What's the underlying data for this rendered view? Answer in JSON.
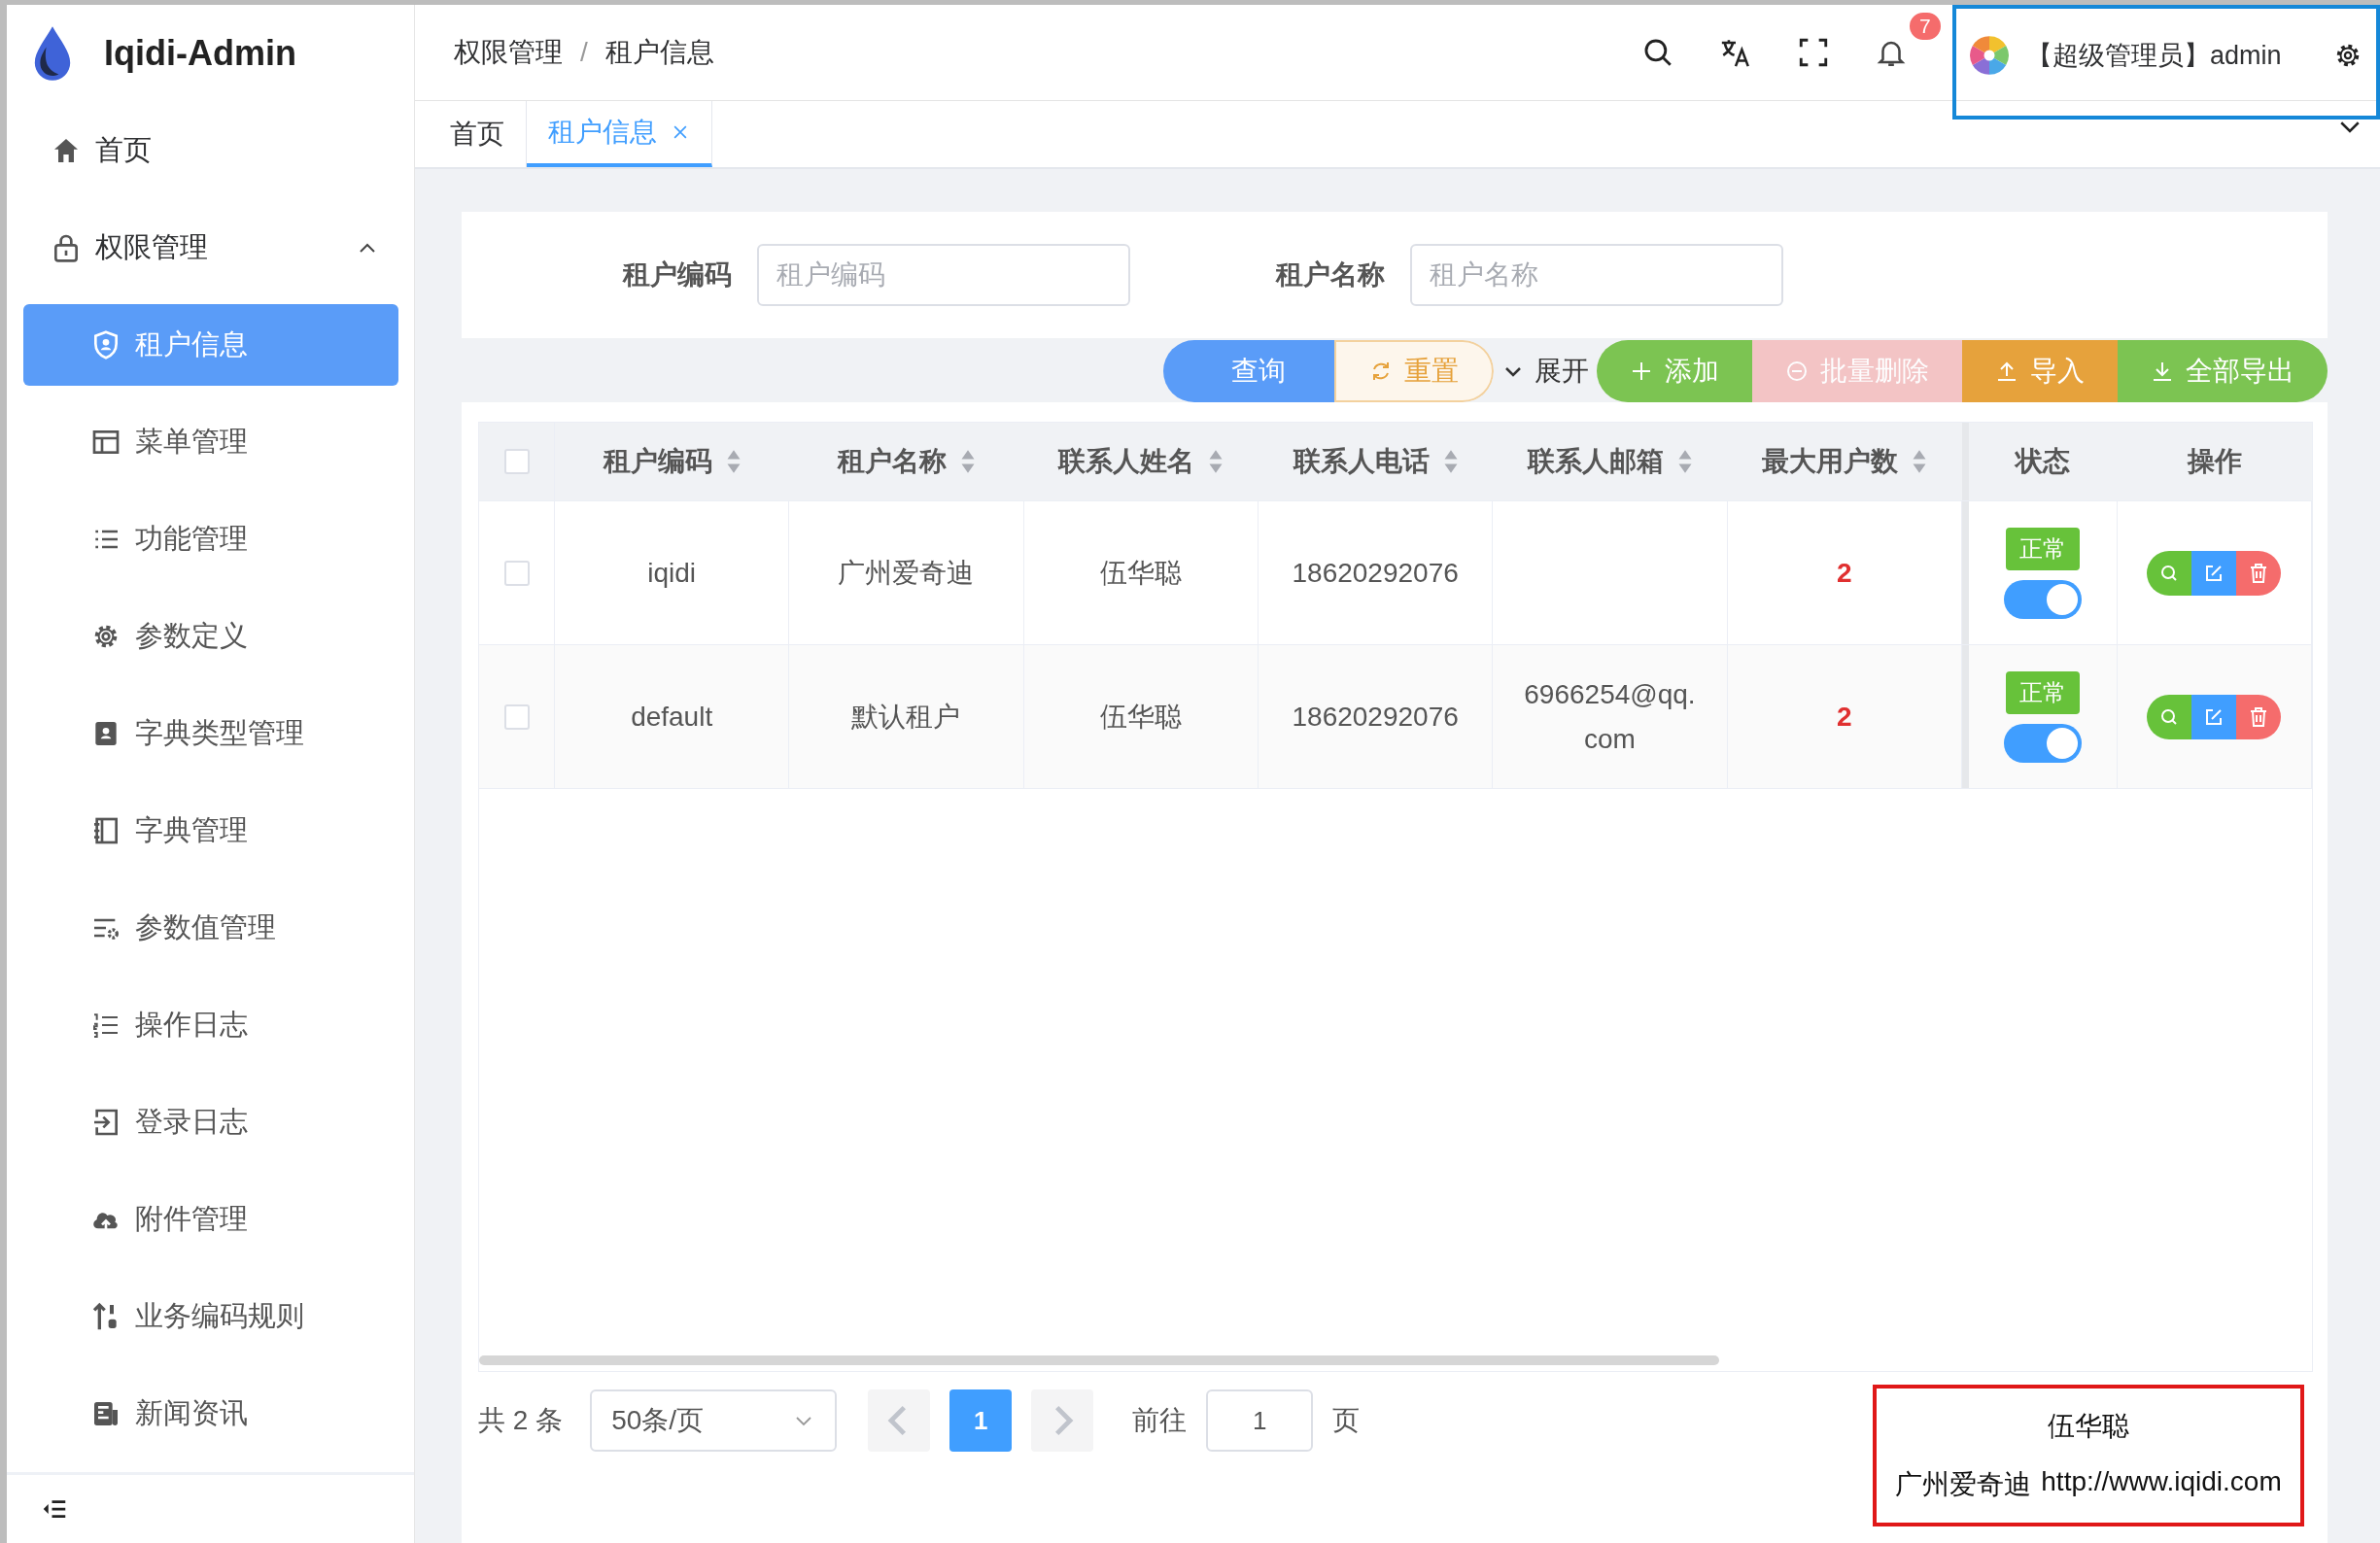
{
  "app": {
    "title": "Iqidi-Admin"
  },
  "sidebar": {
    "items": [
      {
        "label": "首页",
        "kind": "link",
        "selected": false
      },
      {
        "label": "权限管理",
        "kind": "group",
        "expanded": true,
        "children": [
          {
            "label": "租户信息",
            "selected": true
          },
          {
            "label": "菜单管理",
            "selected": false
          },
          {
            "label": "功能管理",
            "selected": false
          },
          {
            "label": "参数定义",
            "selected": false
          },
          {
            "label": "字典类型管理",
            "selected": false
          },
          {
            "label": "字典管理",
            "selected": false
          },
          {
            "label": "参数值管理",
            "selected": false
          },
          {
            "label": "操作日志",
            "selected": false
          },
          {
            "label": "登录日志",
            "selected": false
          },
          {
            "label": "附件管理",
            "selected": false
          },
          {
            "label": "业务编码规则",
            "selected": false
          },
          {
            "label": "新闻资讯",
            "selected": false
          }
        ]
      }
    ]
  },
  "header": {
    "breadcrumb": [
      "权限管理",
      "租户信息"
    ],
    "breadcrumb_separator": "/",
    "notification_count": "7",
    "user": "【超级管理员】admin"
  },
  "tabs": [
    {
      "label": "首页",
      "selected": false,
      "closable": false
    },
    {
      "label": "租户信息",
      "selected": true,
      "closable": true
    }
  ],
  "search": {
    "fields": [
      {
        "label": "租户编码",
        "placeholder": "租户编码"
      },
      {
        "label": "租户名称",
        "placeholder": "租户名称"
      }
    ],
    "buttons": [
      {
        "label": "查询",
        "kind": "primary"
      },
      {
        "label": "重置",
        "kind": "reset"
      }
    ],
    "expand": {
      "label": "展开",
      "expanded": false
    }
  },
  "actions": [
    {
      "label": "添加",
      "kind": "add",
      "disabled": false
    },
    {
      "label": "批量删除",
      "kind": "delete",
      "disabled": true
    },
    {
      "label": "导入",
      "kind": "import",
      "disabled": false
    },
    {
      "label": "全部导出",
      "kind": "export",
      "disabled": false
    }
  ],
  "table": {
    "select_all": {
      "checked": false
    },
    "columns": [
      {
        "label": "租户编码",
        "sortable": true
      },
      {
        "label": "租户名称",
        "sortable": true
      },
      {
        "label": "联系人姓名",
        "sortable": true
      },
      {
        "label": "联系人电话",
        "sortable": true
      },
      {
        "label": "联系人邮箱",
        "sortable": true
      },
      {
        "label": "最大用户数",
        "sortable": true
      },
      {
        "label": "状态",
        "sortable": false
      },
      {
        "label": "操作",
        "sortable": false
      }
    ],
    "rows": [
      {
        "checked": false,
        "code": "iqidi",
        "name": "广州爱奇迪",
        "contact": "伍华聪",
        "phone": "18620292076",
        "max_users": "2",
        "status": "正常",
        "enabled": true
      },
      {
        "checked": false,
        "code": "default",
        "name": "默认租户",
        "contact": "伍华聪",
        "phone": "18620292076",
        "email": "6966254@qq.com",
        "max_users": "2",
        "status": "正常",
        "enabled": true
      }
    ]
  },
  "pagination": {
    "total": "共 2 条",
    "page_size": "50条/页",
    "pages": [
      {
        "label": "1",
        "selected": true
      }
    ],
    "goto_label": "前往",
    "goto_value": "1",
    "page_suffix": "页"
  },
  "contact_card": {
    "name": "伍华聪",
    "company": "广州爱奇迪",
    "url": "http://www.iqidi.com"
  }
}
